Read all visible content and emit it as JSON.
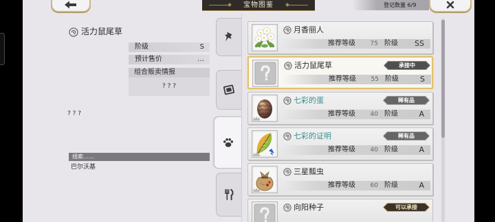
{
  "header": {
    "back_icon": "arrow-left-icon",
    "title": "宝物图鉴",
    "count_label": "登记数量 6/9",
    "close_icon": "close-icon"
  },
  "detail": {
    "icon": "seal-icon",
    "name": "活力鼠尾草",
    "rank_label": "阶级",
    "rank_value": "S",
    "price_label": "预计售价",
    "price_value": "…",
    "combo_label": "组合贩卖情报",
    "combo_value": "? ? ?",
    "description": "? ? ?",
    "clue_label": "线索……",
    "clue_value": "巴尔沃基"
  },
  "tabs": [
    {
      "icon": "pin-icon",
      "selected": false
    },
    {
      "icon": "card-icon",
      "selected": false
    },
    {
      "icon": "paw-icon",
      "selected": true
    },
    {
      "icon": "fork-knife-icon",
      "selected": false
    }
  ],
  "list": {
    "level_label": "推荐等级",
    "rank_label": "阶级",
    "items": [
      {
        "name": "月香丽人",
        "image": "flower-icon",
        "level": "75",
        "rank": "SS",
        "selected": false
      },
      {
        "name": "活力鼠尾草",
        "image": "unknown-item-icon",
        "level": "55",
        "rank": "S",
        "badge": "承接中",
        "selected": true
      },
      {
        "name": "七彩的蛋",
        "image": "egg-icon",
        "level": "40",
        "rank": "A",
        "badge": "稀有品",
        "selected": false,
        "name_color": "#3a8d90"
      },
      {
        "name": "七彩的证明",
        "image": "feather-icon",
        "level": "40",
        "rank": "A",
        "badge": "稀有品",
        "selected": false,
        "name_color": "#3a8d90"
      },
      {
        "name": "三星瓢虫",
        "image": "bag-icon",
        "level": "60",
        "rank": "A",
        "selected": false
      },
      {
        "name": "向阳种子",
        "image": "unknown-item-icon",
        "badge": "可以承接",
        "selected": false
      }
    ]
  },
  "colors": {
    "background": "#e9e6eb",
    "accent_gold": "#d9b65e",
    "rare_name": "#3a8d90",
    "title_banner": "#2f2b28"
  }
}
